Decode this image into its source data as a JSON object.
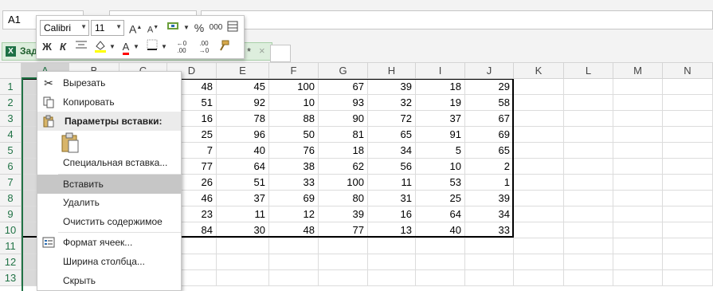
{
  "name_box": "A1",
  "doc_tab": {
    "label": "Зад",
    "modified_mark": "*",
    "close_glyph": "×"
  },
  "columns": [
    "A",
    "B",
    "C",
    "D",
    "E",
    "F",
    "G",
    "H",
    "I",
    "J",
    "K",
    "L",
    "M",
    "N"
  ],
  "rows": [
    "1",
    "2",
    "3",
    "4",
    "5",
    "6",
    "7",
    "8",
    "9",
    "10",
    "11",
    "12",
    "13"
  ],
  "table": [
    [
      "48",
      "45",
      "100",
      "67",
      "39",
      "18",
      "29"
    ],
    [
      "51",
      "92",
      "10",
      "93",
      "32",
      "19",
      "58"
    ],
    [
      "16",
      "78",
      "88",
      "90",
      "72",
      "37",
      "67"
    ],
    [
      "25",
      "96",
      "50",
      "81",
      "65",
      "91",
      "69"
    ],
    [
      "7",
      "40",
      "76",
      "18",
      "34",
      "5",
      "65"
    ],
    [
      "77",
      "64",
      "38",
      "62",
      "56",
      "10",
      "2"
    ],
    [
      "26",
      "51",
      "33",
      "100",
      "11",
      "53",
      "1"
    ],
    [
      "46",
      "37",
      "69",
      "80",
      "31",
      "25",
      "39"
    ],
    [
      "23",
      "11",
      "12",
      "39",
      "16",
      "64",
      "34"
    ],
    [
      "84",
      "30",
      "48",
      "77",
      "13",
      "40",
      "33"
    ]
  ],
  "mini_toolbar": {
    "font": "Calibri",
    "size": "11",
    "grow_font": "A",
    "shrink_font": "A",
    "percent": "%",
    "thousands": "000",
    "bold": "Ж",
    "italic": "К",
    "font_color": "A",
    "inc_decimal": "←0 .00",
    "dec_decimal": ".00 →0"
  },
  "context_menu": {
    "cut": "Вырезать",
    "copy": "Копировать",
    "paste_options": "Параметры вставки:",
    "paste_special": "Специальная вставка...",
    "insert": "Вставить",
    "delete": "Удалить",
    "clear": "Очистить содержимое",
    "format_cells": "Формат ячеек...",
    "col_width": "Ширина столбца...",
    "hide": "Скрыть"
  },
  "colors": {
    "accent": "#217346",
    "highlight": "#c6c6c6",
    "header_bg": "#f3f3f3"
  }
}
